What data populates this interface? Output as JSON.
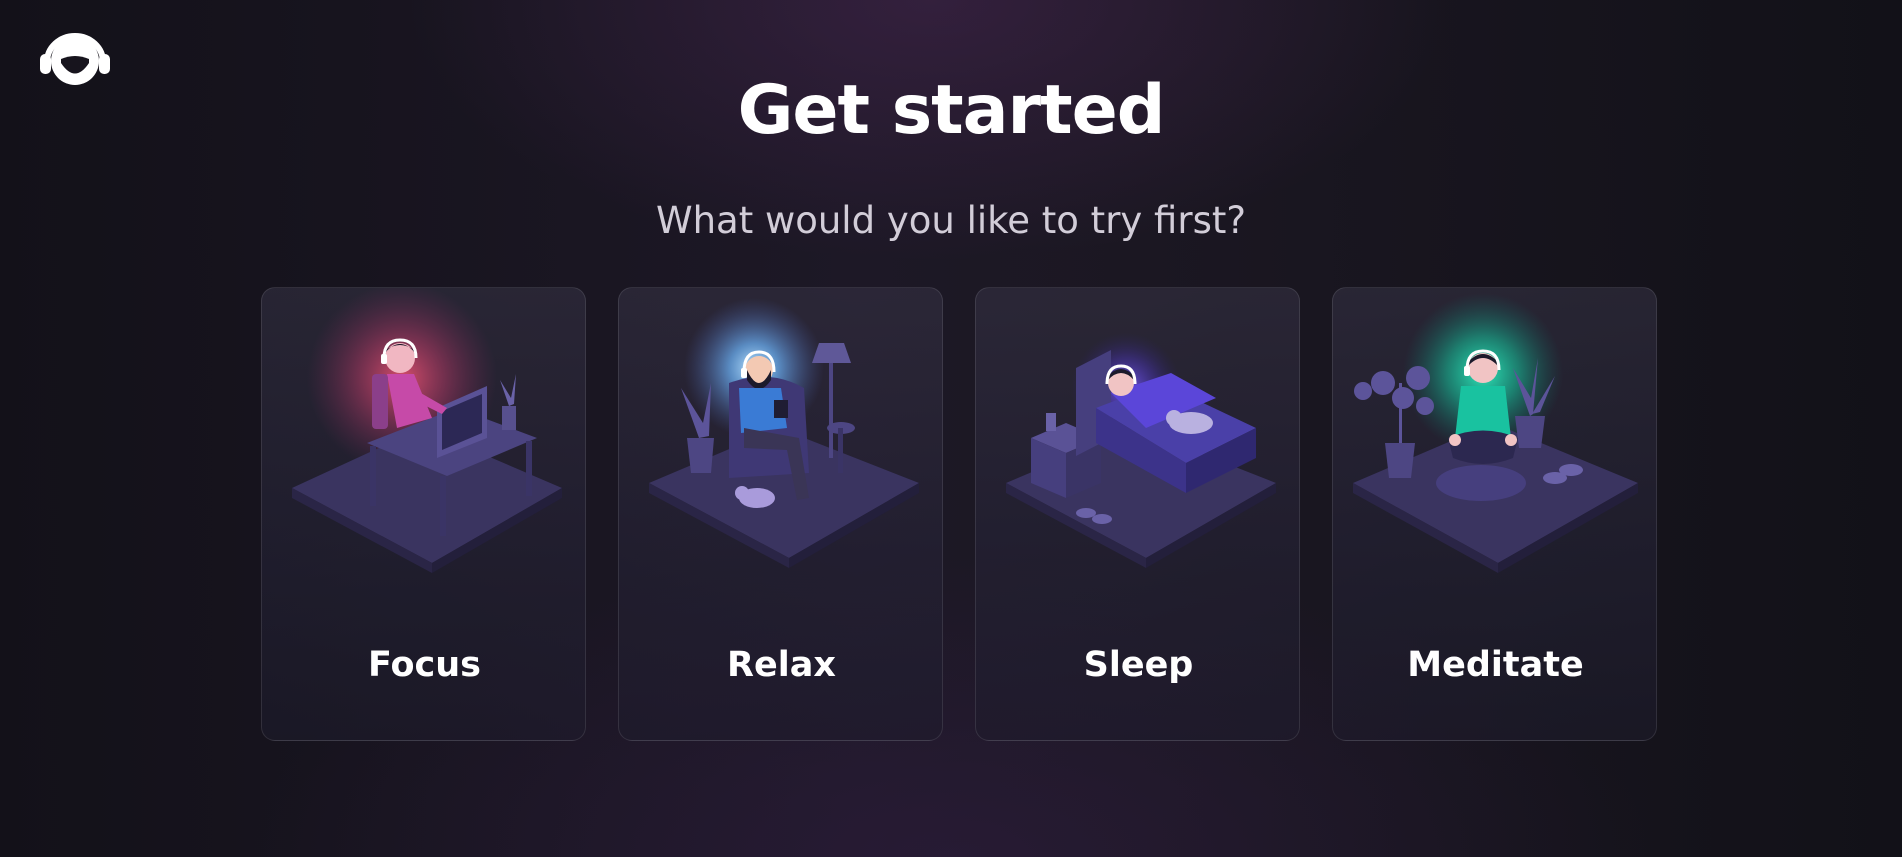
{
  "app": {
    "logo_icon": "headphones-face-icon"
  },
  "header": {
    "title": "Get started",
    "subtitle": "What would you like to try first?"
  },
  "options": [
    {
      "label": "Focus",
      "icon": "desk-workspace-illustration",
      "glow_color": "#e0506e"
    },
    {
      "label": "Relax",
      "icon": "armchair-relax-illustration",
      "glow_color": "#6fb8ff"
    },
    {
      "label": "Sleep",
      "icon": "bed-sleep-illustration",
      "glow_color": "#5b3dd8"
    },
    {
      "label": "Meditate",
      "icon": "meditation-illustration",
      "glow_color": "#16c8a0"
    }
  ],
  "colors": {
    "background": "#17141d",
    "card_floor": "#3a3460",
    "text": "#ffffff",
    "subtitle_text": "#d2cdd8"
  }
}
